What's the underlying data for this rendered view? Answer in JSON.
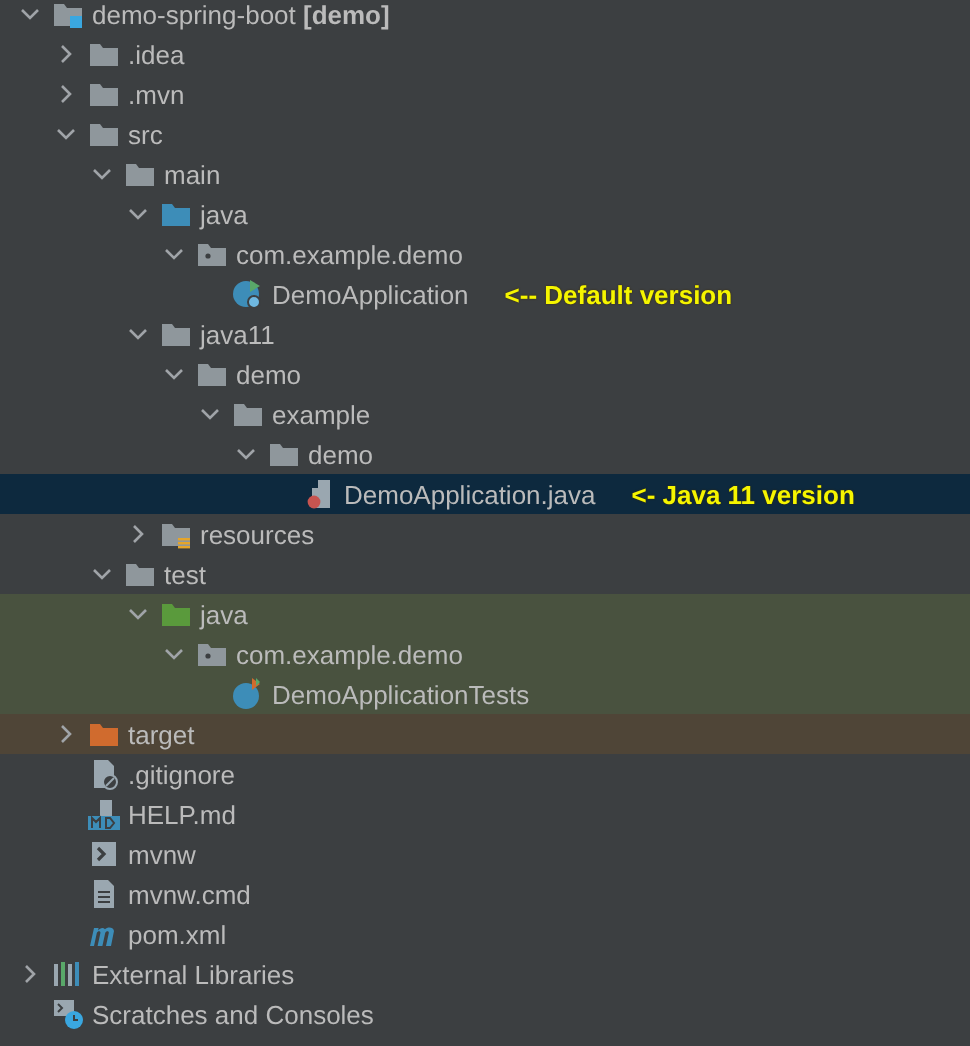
{
  "tree": [
    {
      "label": "demo-spring-boot **[demo]**",
      "kind": "module",
      "expanded": true,
      "selected": false,
      "children": [
        {
          "label": ".idea",
          "kind": "folder",
          "expanded": false,
          "selected": false
        },
        {
          "label": ".mvn",
          "kind": "folder",
          "expanded": false,
          "selected": false
        },
        {
          "label": "src",
          "kind": "folder",
          "expanded": true,
          "selected": false,
          "children": [
            {
              "label": "main",
              "kind": "folder",
              "expanded": true,
              "selected": false,
              "children": [
                {
                  "label": "java",
                  "kind": "source-folder",
                  "expanded": true,
                  "selected": false,
                  "children": [
                    {
                      "label": "com.example.demo",
                      "kind": "package",
                      "expanded": true,
                      "selected": false,
                      "children": [
                        {
                          "label": "DemoApplication",
                          "kind": "app-class",
                          "selected": false,
                          "annotation": "<-- Default version"
                        }
                      ]
                    }
                  ]
                },
                {
                  "label": "java11",
                  "kind": "folder",
                  "expanded": true,
                  "selected": false,
                  "children": [
                    {
                      "label": "demo",
                      "kind": "folder",
                      "expanded": true,
                      "selected": false,
                      "children": [
                        {
                          "label": "example",
                          "kind": "folder",
                          "expanded": true,
                          "selected": false,
                          "children": [
                            {
                              "label": "demo",
                              "kind": "folder",
                              "expanded": true,
                              "selected": false,
                              "children": [
                                {
                                  "label": "DemoApplication.java",
                                  "kind": "java-file",
                                  "selected": true,
                                  "annotation": "<- Java 11 version"
                                }
                              ]
                            }
                          ]
                        }
                      ]
                    }
                  ]
                },
                {
                  "label": "resources",
                  "kind": "resources-folder",
                  "expanded": false,
                  "selected": false
                }
              ]
            },
            {
              "label": "test",
              "kind": "folder",
              "expanded": true,
              "selected": false,
              "children": [
                {
                  "label": "java",
                  "kind": "test-folder",
                  "color": "#49523f",
                  "expanded": true,
                  "selected": false,
                  "children": [
                    {
                      "label": "com.example.demo",
                      "kind": "package",
                      "color": "#49523f",
                      "expanded": true,
                      "selected": false,
                      "children": [
                        {
                          "label": "DemoApplicationTests",
                          "kind": "test-class",
                          "color": "#49523f",
                          "selected": false
                        }
                      ]
                    }
                  ]
                }
              ]
            }
          ]
        },
        {
          "label": "target",
          "kind": "excluded-folder",
          "color": "#4f4537",
          "expanded": false,
          "selected": false
        },
        {
          "label": ".gitignore",
          "kind": "ignore-file",
          "selected": false
        },
        {
          "label": "HELP.md",
          "kind": "markdown-file",
          "selected": false
        },
        {
          "label": "mvnw",
          "kind": "script-file",
          "selected": false
        },
        {
          "label": "mvnw.cmd",
          "kind": "text-file",
          "selected": false
        },
        {
          "label": "pom.xml",
          "kind": "maven-file",
          "selected": false
        }
      ]
    },
    {
      "label": "External Libraries",
      "kind": "libraries",
      "expanded": false,
      "selected": false
    },
    {
      "label": "Scratches and Consoles",
      "kind": "scratches",
      "selected": false
    }
  ]
}
